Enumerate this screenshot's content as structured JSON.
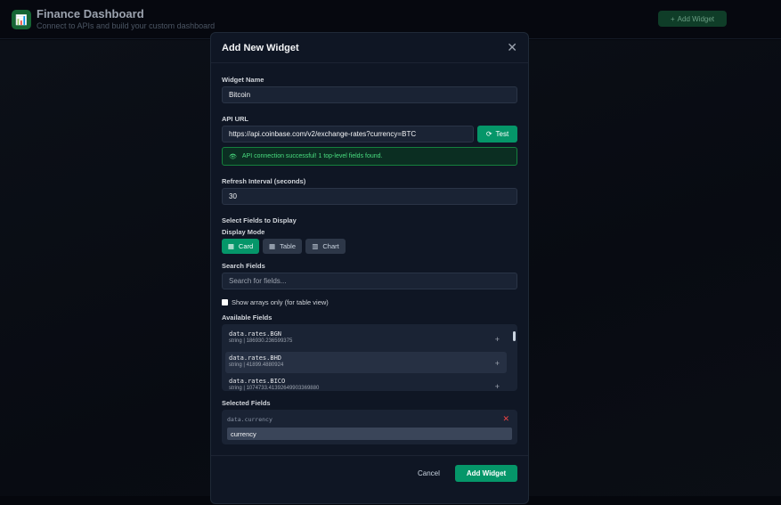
{
  "app": {
    "title": "Finance Dashboard",
    "subtitle": "Connect to APIs and build your custom dashboard",
    "add_widget": "Add Widget"
  },
  "modal": {
    "title": "Add New Widget",
    "widget_name_label": "Widget Name",
    "widget_name_value": "Bitcoin",
    "api_url_label": "API URL",
    "api_url_value": "https://api.coinbase.com/v2/exchange-rates?currency=BTC",
    "test_label": "Test",
    "success_message": "API connection successful! 1 top-level fields found.",
    "refresh_label": "Refresh Interval (seconds)",
    "refresh_value": "30",
    "select_fields_label": "Select Fields to Display",
    "display_mode_label": "Display Mode",
    "modes": [
      {
        "label": "Card",
        "active": true
      },
      {
        "label": "Table",
        "active": false
      },
      {
        "label": "Chart",
        "active": false
      }
    ],
    "search_label": "Search Fields",
    "search_placeholder": "Search for fields...",
    "arrays_only_label": "Show arrays only (for table view)",
    "available_label": "Available Fields",
    "available_fields": [
      {
        "name": "data.rates.BGN",
        "info": "string | 186930.236599375"
      },
      {
        "name": "data.rates.BHD",
        "info": "string | 41899.4880924"
      },
      {
        "name": "data.rates.BICO",
        "info": "string | 1074733.41392649903369880"
      }
    ],
    "selected_label": "Selected Fields",
    "selected_fields": [
      {
        "name": "data.currency",
        "alias": "currency"
      }
    ],
    "cancel": "Cancel",
    "submit": "Add Widget"
  }
}
